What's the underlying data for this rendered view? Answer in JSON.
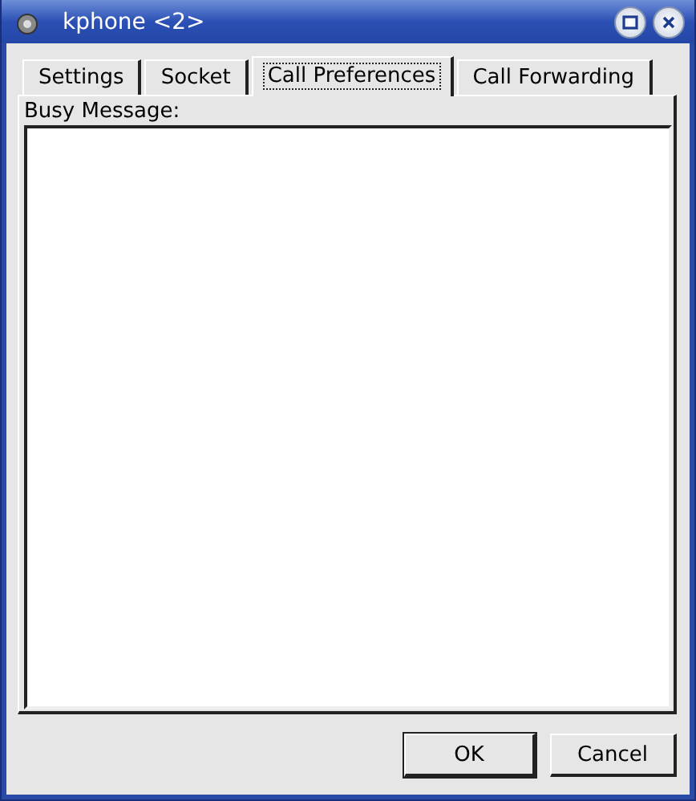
{
  "window": {
    "title": "kphone <2>"
  },
  "tabs": [
    {
      "label": "Settings",
      "selected": false
    },
    {
      "label": "Socket",
      "selected": false
    },
    {
      "label": "Call Preferences",
      "selected": true
    },
    {
      "label": "Call Forwarding",
      "selected": false
    }
  ],
  "busy_message": {
    "label": "Busy Message:"
  },
  "buttons": [
    {
      "label": "OK",
      "default": true
    },
    {
      "label": "Cancel",
      "default": false
    }
  ]
}
